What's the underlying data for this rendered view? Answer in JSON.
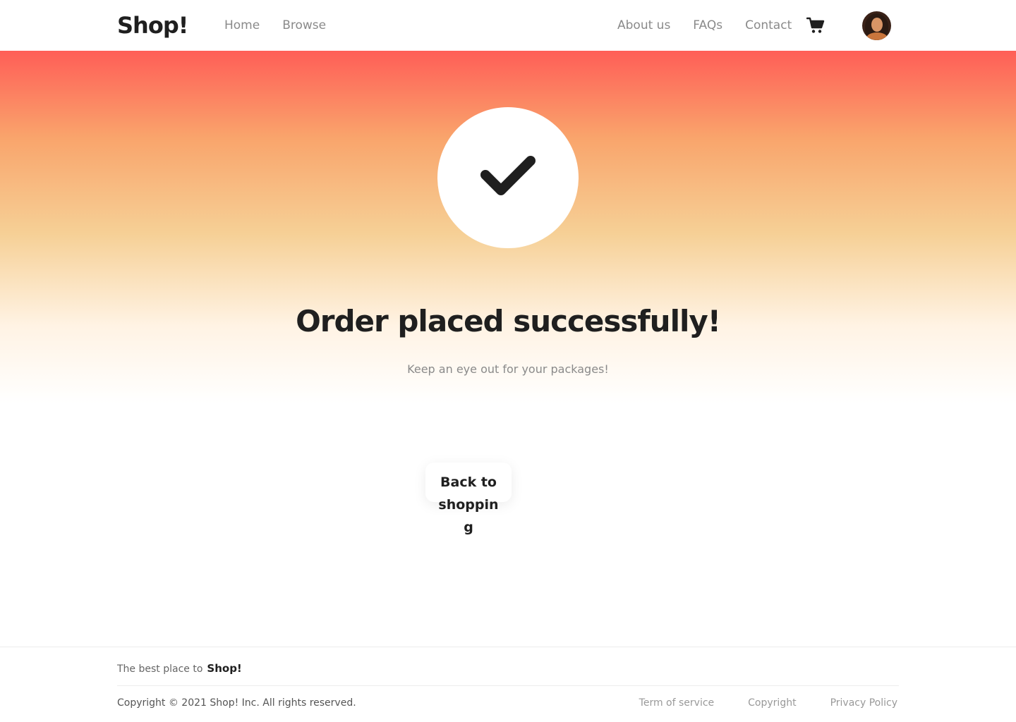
{
  "header": {
    "logo": "Shop!",
    "nav_left": [
      {
        "label": "Home"
      },
      {
        "label": "Browse"
      }
    ],
    "nav_right": [
      {
        "label": "About us"
      },
      {
        "label": "FAQs"
      },
      {
        "label": "Contact"
      }
    ],
    "cart_icon": "cart-icon",
    "avatar_icon": "user-avatar"
  },
  "hero": {
    "icon": "checkmark-icon",
    "title": "Order placed successfully!",
    "subtitle": "Keep an eye out for your packages!",
    "gradient_colors": [
      "#ff5e57",
      "#f9a56c",
      "#f6d096",
      "#ffffff"
    ]
  },
  "actions": {
    "back_label": "Back to shopping"
  },
  "footer": {
    "tagline": "The best place to",
    "tagline_brand": "Shop!",
    "copyright": "Copyright © 2021 Shop! Inc. All rights reserved.",
    "links": [
      {
        "label": "Term of service"
      },
      {
        "label": "Copyright"
      },
      {
        "label": "Privacy Policy"
      }
    ]
  }
}
